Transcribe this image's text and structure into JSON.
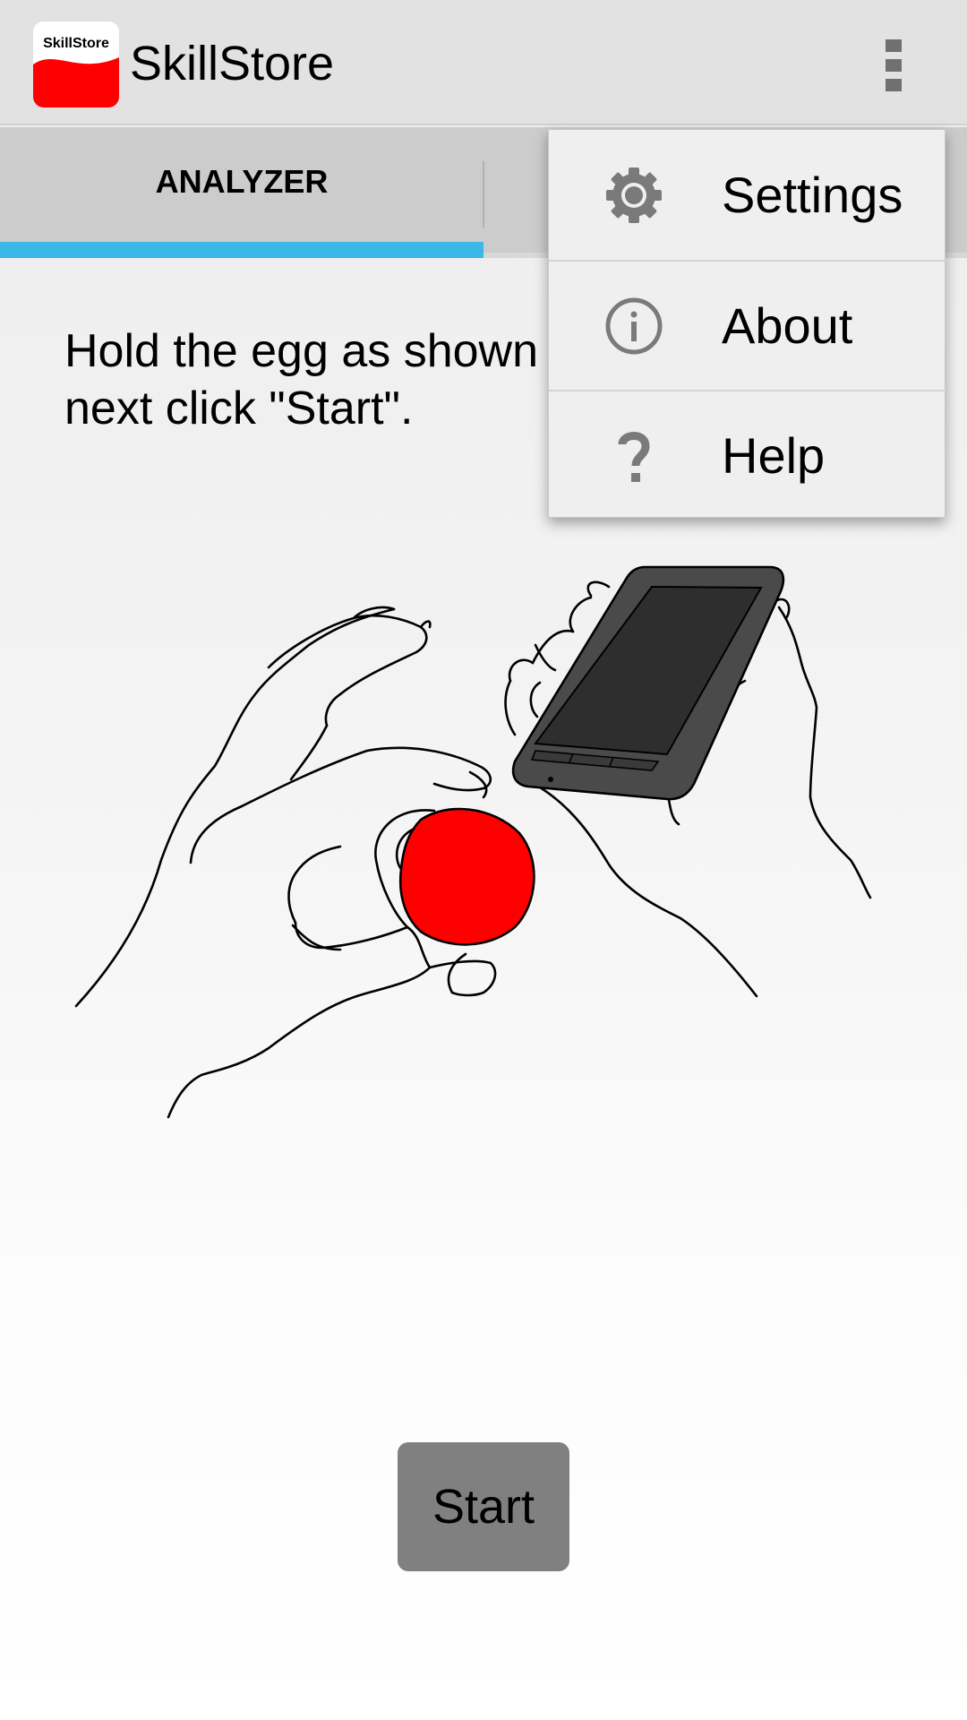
{
  "app": {
    "title": "SkillStore",
    "icon_text": "SkillStore",
    "icon_name": "skillstore-logo"
  },
  "tabs": [
    {
      "label": "ANALYZER",
      "selected": true
    }
  ],
  "instruction": {
    "line1": "Hold the egg as shown",
    "line2": "next click \"Start\"."
  },
  "start_button": {
    "label": "Start"
  },
  "menu": {
    "items": [
      {
        "label": "Settings",
        "icon": "gear-icon"
      },
      {
        "label": "About",
        "icon": "info-icon"
      },
      {
        "label": "Help",
        "icon": "question-icon"
      }
    ]
  },
  "colors": {
    "accent": "#3bb8e8",
    "egg": "#ff0000",
    "button": "#808080",
    "logo_red": "#ff0000"
  }
}
